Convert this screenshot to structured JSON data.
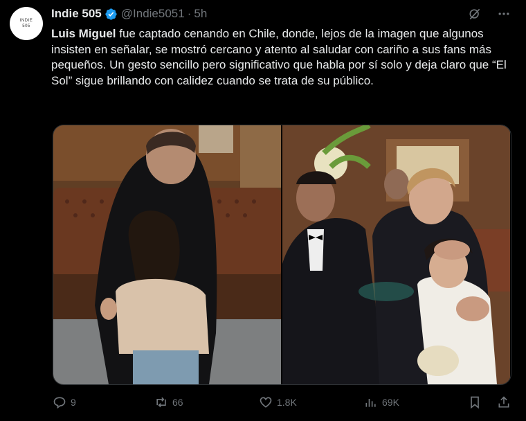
{
  "author": {
    "avatar_text_top": "INDIE",
    "avatar_text_bottom": "505",
    "name": "Indie 505",
    "handle": "@Indie5051",
    "separator": "·",
    "time": "5h"
  },
  "post": {
    "bold_name": "Luis Miguel",
    "text": " fue captado  cenando en Chile, donde, lejos de la imagen que algunos insisten en señalar, se mostró cercano y atento al saludar con cariño a sus fans más pequeños. Un gesto sencillo pero significativo que habla por sí solo y deja claro que “El Sol” sigue brillando con calidez cuando se trata de su público."
  },
  "actions": {
    "replies": "9",
    "reposts": "66",
    "likes": "1.8K",
    "views": "69K"
  },
  "icons": [
    "verified-badge-icon",
    "grok-icon",
    "more-icon",
    "reply-icon",
    "repost-icon",
    "like-icon",
    "views-icon",
    "bookmark-icon",
    "share-icon"
  ],
  "colors": {
    "background": "#000000",
    "text": "#e7e9ea",
    "muted": "#71767b",
    "verified": "#1d9bf0"
  }
}
